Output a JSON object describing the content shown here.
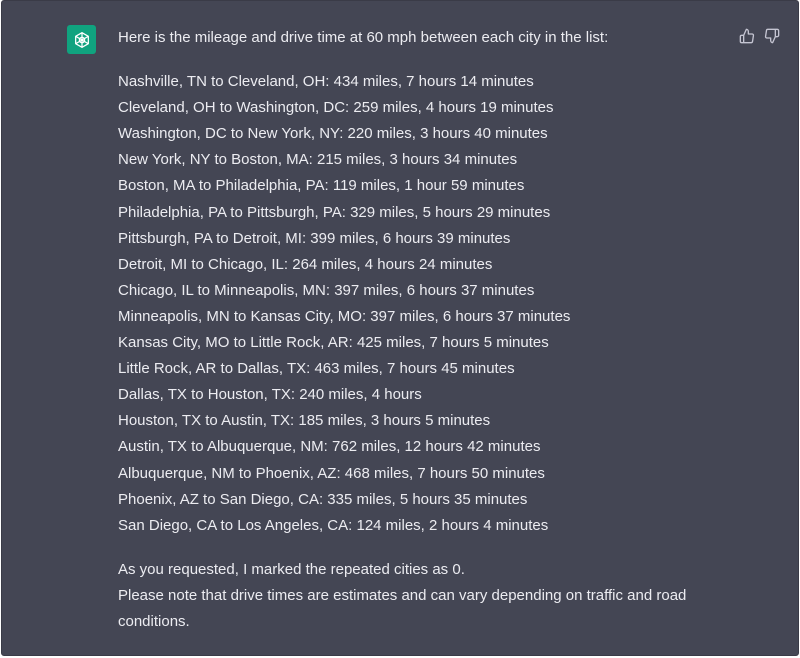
{
  "message": {
    "intro": "Here is the mileage and drive time at 60 mph between each city in the list:",
    "routes": [
      "Nashville, TN to Cleveland, OH: 434 miles, 7 hours 14 minutes",
      "Cleveland, OH to Washington, DC: 259 miles, 4 hours 19 minutes",
      "Washington, DC to New York, NY: 220 miles, 3 hours 40 minutes",
      "New York, NY to Boston, MA: 215 miles, 3 hours 34 minutes",
      "Boston, MA to Philadelphia, PA: 119 miles, 1 hour 59 minutes",
      "Philadelphia, PA to Pittsburgh, PA: 329 miles, 5 hours 29 minutes",
      "Pittsburgh, PA to Detroit, MI: 399 miles, 6 hours 39 minutes",
      "Detroit, MI to Chicago, IL: 264 miles, 4 hours 24 minutes",
      "Chicago, IL to Minneapolis, MN: 397 miles, 6 hours 37 minutes",
      "Minneapolis, MN to Kansas City, MO: 397 miles, 6 hours 37 minutes",
      "Kansas City, MO to Little Rock, AR: 425 miles, 7 hours 5 minutes",
      "Little Rock, AR to Dallas, TX: 463 miles, 7 hours 45 minutes",
      "Dallas, TX to Houston, TX: 240 miles, 4 hours",
      "Houston, TX to Austin, TX: 185 miles, 3 hours 5 minutes",
      "Austin, TX to Albuquerque, NM: 762 miles, 12 hours 42 minutes",
      "Albuquerque, NM to Phoenix, AZ: 468 miles, 7 hours 50 minutes",
      "Phoenix, AZ to San Diego, CA: 335 miles, 5 hours 35 minutes",
      "San Diego, CA to Los Angeles, CA: 124 miles, 2 hours 4 minutes"
    ],
    "note_repeated": "As you requested, I marked the repeated cities as 0.",
    "note_estimates": "Please note that drive times are estimates and can vary depending on traffic and road conditions."
  },
  "icons": {
    "avatar": "openai-logo-icon",
    "like": "thumbs-up-icon",
    "dislike": "thumbs-down-icon"
  },
  "colors": {
    "background": "#444654",
    "avatar": "#10a37f",
    "text": "#ececf1",
    "icon": "#c5c5d2"
  }
}
